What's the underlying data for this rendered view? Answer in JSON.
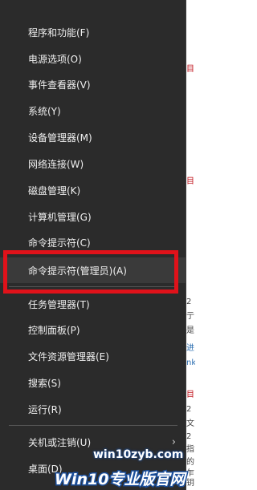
{
  "menu": {
    "items": [
      {
        "label": "程序和功能(F)",
        "key": "programs-features"
      },
      {
        "label": "电源选项(O)",
        "key": "power-options"
      },
      {
        "label": "事件查看器(V)",
        "key": "event-viewer"
      },
      {
        "label": "系统(Y)",
        "key": "system"
      },
      {
        "label": "设备管理器(M)",
        "key": "device-manager"
      },
      {
        "label": "网络连接(W)",
        "key": "network-connections"
      },
      {
        "label": "磁盘管理(K)",
        "key": "disk-management"
      },
      {
        "label": "计算机管理(G)",
        "key": "computer-management"
      },
      {
        "label": "命令提示符(C)",
        "key": "command-prompt"
      },
      {
        "label": "命令提示符(管理员)(A)",
        "key": "command-prompt-admin"
      },
      {
        "label": "任务管理器(T)",
        "key": "task-manager"
      },
      {
        "label": "控制面板(P)",
        "key": "control-panel"
      },
      {
        "label": "文件资源管理器(E)",
        "key": "file-explorer"
      },
      {
        "label": "搜索(S)",
        "key": "search"
      },
      {
        "label": "运行(R)",
        "key": "run"
      },
      {
        "label": "关机或注销(U)",
        "key": "shutdown-signout"
      },
      {
        "label": "桌面(D)",
        "key": "desktop"
      }
    ],
    "submenu_arrow": "›"
  },
  "watermark": {
    "url": "win10zyb.com",
    "brand": "Win10专业版官网"
  },
  "background_window": {
    "fragments": [
      "目",
      "目",
      "2",
      "亍",
      "是",
      "进",
      "nk",
      "目",
      "2",
      "文",
      "2",
      "指",
      "的",
      "乍",
      "钥"
    ]
  },
  "colors": {
    "menu_bg": "#2b2b2b",
    "menu_text": "#f0f0f0",
    "highlight_bg": "#3a3a3a",
    "annotation_red": "#e0121a"
  }
}
